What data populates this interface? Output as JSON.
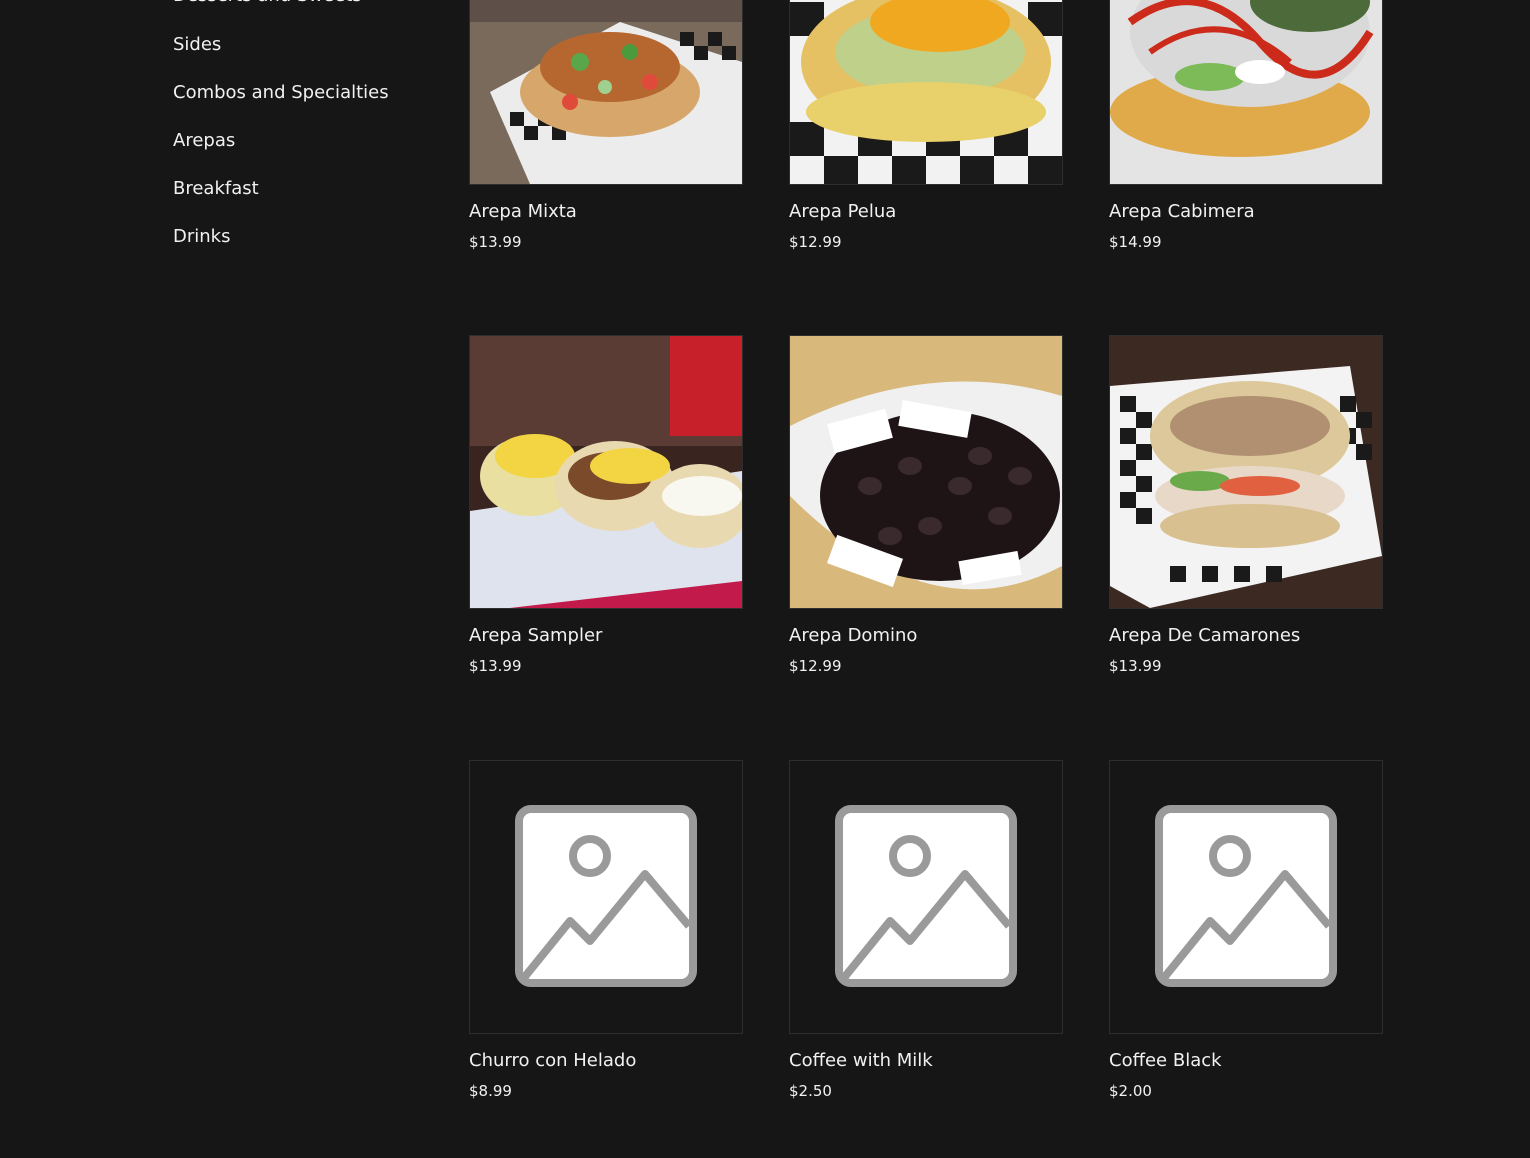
{
  "sidebar": {
    "categories": [
      {
        "label": "Desserts and Sweets"
      },
      {
        "label": "Sides"
      },
      {
        "label": "Combos and Specialties"
      },
      {
        "label": "Arepas"
      },
      {
        "label": "Breakfast"
      },
      {
        "label": "Drinks"
      }
    ]
  },
  "products": [
    {
      "name": "Arepa Mixta",
      "price": "$13.99",
      "image": "photo"
    },
    {
      "name": "Arepa Pelua",
      "price": "$12.99",
      "image": "photo"
    },
    {
      "name": "Arepa Cabimera",
      "price": "$14.99",
      "image": "photo"
    },
    {
      "name": "Arepa Sampler",
      "price": "$13.99",
      "image": "photo"
    },
    {
      "name": "Arepa Domino",
      "price": "$12.99",
      "image": "photo"
    },
    {
      "name": "Arepa De Camarones",
      "price": "$13.99",
      "image": "photo"
    },
    {
      "name": "Churro con Helado",
      "price": "$8.99",
      "image": "placeholder-image-icon"
    },
    {
      "name": "Coffee with Milk",
      "price": "$2.50",
      "image": "placeholder-image-icon"
    },
    {
      "name": "Coffee Black",
      "price": "$2.00",
      "image": "placeholder-image-icon"
    }
  ]
}
